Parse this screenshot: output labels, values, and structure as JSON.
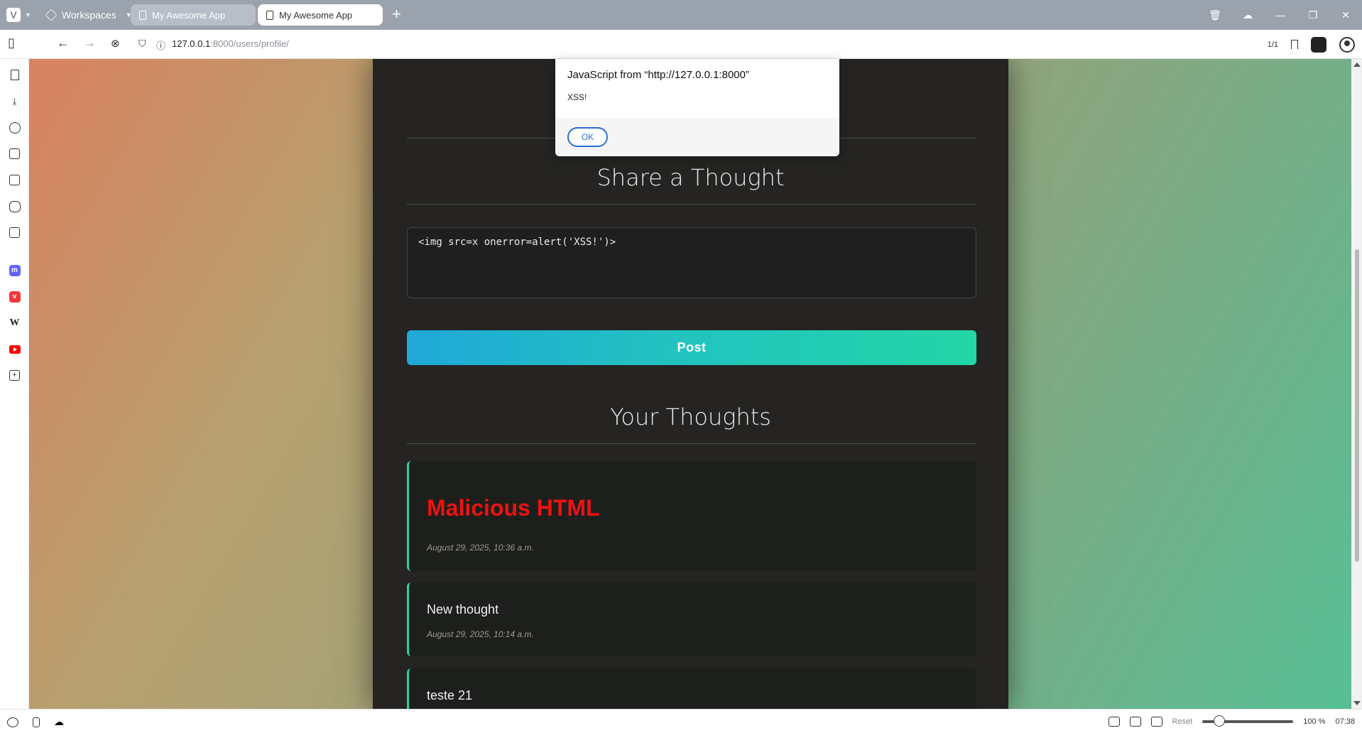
{
  "browser": {
    "workspaces_label": "Workspaces",
    "tabs": [
      {
        "label": "My Awesome App"
      },
      {
        "label": "My Awesome App"
      }
    ],
    "new_tab": "+",
    "url_host": "127.0.0.1",
    "url_path": ":8000/users/profile/",
    "find_counter": "1/1"
  },
  "sidebar_icons": [
    "bookmarks-icon",
    "downloads-icon",
    "history-icon",
    "notes-icon",
    "translate-icon",
    "reading-icon",
    "window-icon",
    "mastodon-icon",
    "vivaldi-icon",
    "wikipedia-icon",
    "youtube-icon",
    "add-panel-icon"
  ],
  "page": {
    "share_heading": "Share a Thought",
    "textarea_value": "<img src=x onerror=alert('XSS!')>",
    "post_label": "Post",
    "thoughts_heading": "Your Thoughts",
    "thoughts": [
      {
        "title": "Malicious HTML",
        "date": "August 29, 2025, 10:36 a.m."
      },
      {
        "title": "New thought",
        "date": "August 29, 2025, 10:14 a.m."
      },
      {
        "title": "teste 21",
        "date": ""
      }
    ]
  },
  "alert": {
    "title": "JavaScript from “http://127.0.0.1:8000”",
    "message": "XSS!",
    "ok_label": "OK"
  },
  "status": {
    "reset_label": "Reset",
    "zoom": "100 %",
    "clock": "07:38"
  },
  "colors": {
    "accent": "#2ad0a5",
    "danger_title": "#ee1111",
    "panel_bg": "#252422"
  }
}
